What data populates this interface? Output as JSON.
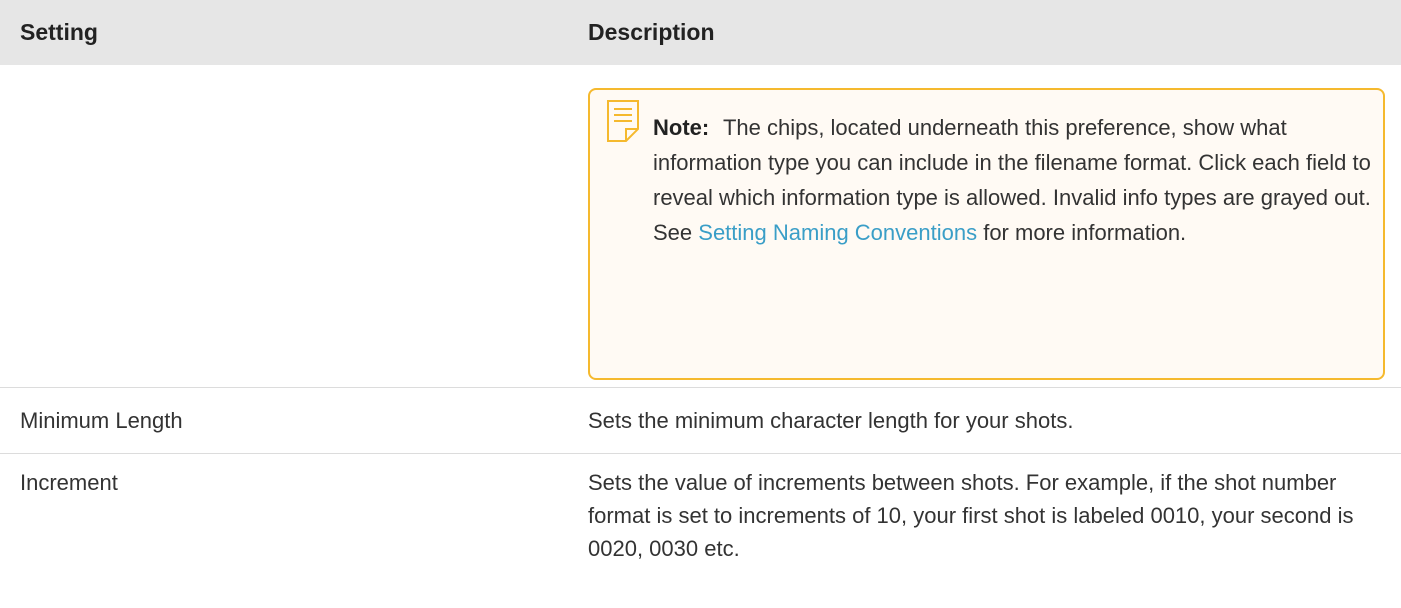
{
  "table": {
    "headers": {
      "setting": "Setting",
      "description": "Description"
    },
    "note": {
      "icon": "note-icon",
      "label": "Note:",
      "text_before_link": "The chips, located underneath this preference, show what information type you can include in the filename format. Click each field to reveal which information type is allowed. Invalid info types are grayed out. See ",
      "link_text": "Setting Naming Conventions",
      "text_after_link": " for more information.",
      "border_color": "#f5b92e",
      "link_color": "#3a9ec7"
    },
    "rows": [
      {
        "setting": "Minimum Length",
        "description": "Sets the minimum character length for your shots."
      },
      {
        "setting": "Increment",
        "description": "Sets the value of increments between shots. For example, if the shot number format is set to increments of 10, your first shot is labeled 0010, your second is 0020, 0030 etc."
      }
    ],
    "header_background": "#e6e6e6"
  }
}
